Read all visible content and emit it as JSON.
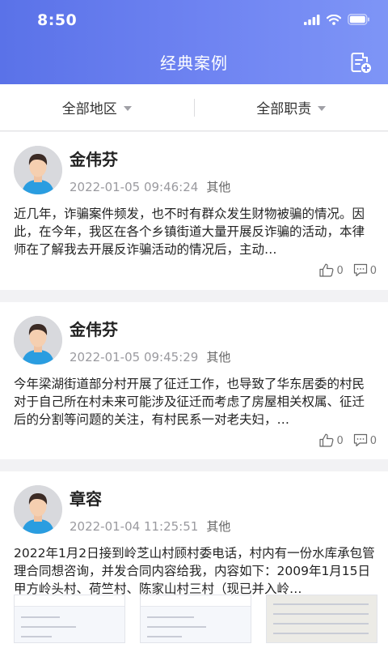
{
  "status": {
    "time": "8:50"
  },
  "header": {
    "title": "经典案例",
    "add_icon": "note-add-icon"
  },
  "filters": [
    {
      "label": "全部地区"
    },
    {
      "label": "全部职责"
    }
  ],
  "cases": [
    {
      "name": "金伟芬",
      "date": "2022-01-05 09:46:24",
      "category": "其他",
      "content": "近几年，诈骗案件频发，也不时有群众发生财物被骗的情况。因此，在今年，我区在各个乡镇街道大量开展反诈骗的活动，本律师在了解我去开展反诈骗活动的情况后，主动…",
      "likes": "0",
      "comments": "0"
    },
    {
      "name": "金伟芬",
      "date": "2022-01-05 09:45:29",
      "category": "其他",
      "content": " 今年梁湖街道部分村开展了征迁工作，也导致了华东居委的村民对于自己所在村未来可能涉及征迁而考虑了房屋相关权属、征迁后的分割等问题的关注，有村民系一对老夫妇，…",
      "likes": "0",
      "comments": "0"
    },
    {
      "name": "章容",
      "date": "2022-01-04 11:25:51",
      "category": "其他",
      "content": "2022年1月2日接到岭芝山村顾村委电话，村内有一份水库承包管理合同想咨询，并发合同内容给我，内容如下：2009年1月15日甲方岭头村、荷竺村、陈家山村三村（现已并入岭…"
    }
  ],
  "colors": {
    "header_start": "#5a72e8",
    "header_end": "#7e95f6"
  }
}
